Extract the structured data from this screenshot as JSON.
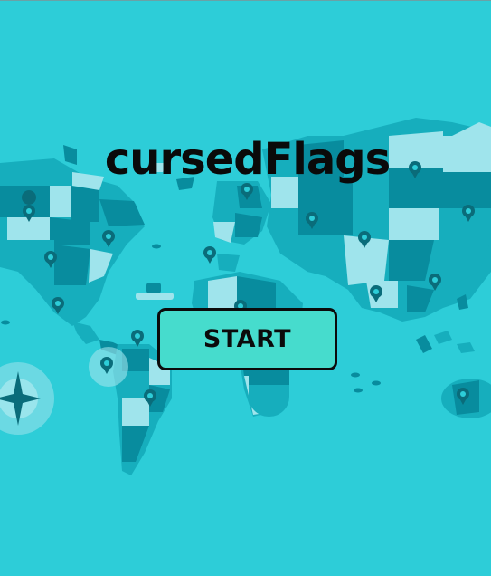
{
  "game": {
    "title": "cursedFlags",
    "start_label": "START"
  },
  "colors": {
    "ocean": "#2dcdd8",
    "land_dark": "#088c9e",
    "land_mid": "#16aebd",
    "land_light": "#9fe4ec",
    "pin": "#0a6c7a",
    "button_fill": "#46dccd",
    "button_border": "#0b0b0b",
    "title_text": "#0a0a0a"
  },
  "background": {
    "description_icon": "world-map-illustration",
    "compass_icon": "compass-star-icon",
    "pin_icon": "map-pin-icon"
  }
}
